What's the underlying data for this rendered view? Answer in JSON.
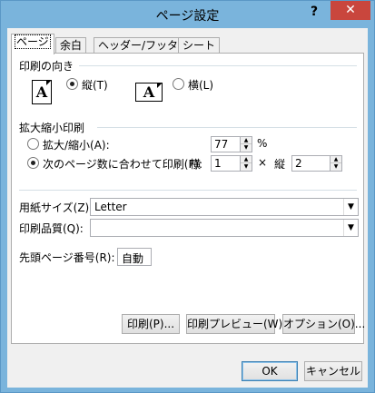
{
  "window": {
    "title": "ページ設定",
    "help_glyph": "?",
    "close_glyph": "✕"
  },
  "tabs": [
    {
      "label": "ページ",
      "active": true
    },
    {
      "label": "余白",
      "active": false
    },
    {
      "label": "ヘッダー/フッター",
      "active": false
    },
    {
      "label": "シート",
      "active": false
    }
  ],
  "orientation": {
    "section_label": "印刷の向き",
    "portrait_label": "縦(T)",
    "landscape_label": "横(L)",
    "selected": "portrait",
    "icon_letter": "A"
  },
  "scaling": {
    "section_label": "拡大縮小印刷",
    "adjust_label": "拡大/縮小(A):",
    "adjust_value": "77",
    "percent_symbol": "%",
    "fit_label": "次のページ数に合わせて印刷(F):",
    "wide_label": "横",
    "wide_value": "1",
    "times_symbol": "×",
    "tall_label": "縦",
    "tall_value": "2",
    "selected": "fit"
  },
  "paper_size": {
    "label": "用紙サイズ(Z):",
    "value": "Letter"
  },
  "print_quality": {
    "label": "印刷品質(Q):",
    "value": ""
  },
  "first_page_number": {
    "label": "先頭ページ番号(R):",
    "value": "自動"
  },
  "panel_buttons": {
    "print": "印刷(P)...",
    "preview": "印刷プレビュー(W)",
    "options": "オプション(O)..."
  },
  "dialog_buttons": {
    "ok": "OK",
    "cancel": "キャンセル"
  }
}
